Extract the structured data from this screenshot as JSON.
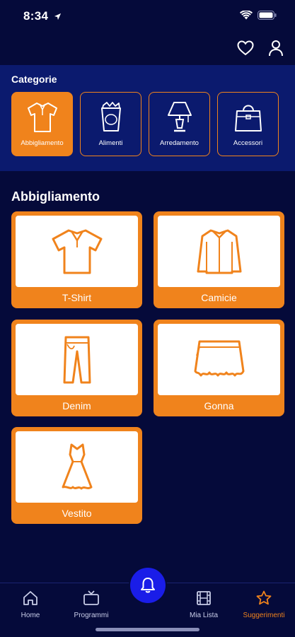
{
  "status": {
    "time": "8:34"
  },
  "categories": {
    "title": "Categorie",
    "items": [
      {
        "label": "Abbigliamento",
        "icon": "shirt-icon",
        "active": true
      },
      {
        "label": "Alimenti",
        "icon": "food-bag-icon",
        "active": false
      },
      {
        "label": "Arredamento",
        "icon": "lamp-icon",
        "active": false
      },
      {
        "label": "Accessori",
        "icon": "handbag-icon",
        "active": false
      }
    ]
  },
  "section": {
    "title": "Abbigliamento"
  },
  "products": [
    {
      "label": "T-Shirt",
      "icon": "tshirt-icon"
    },
    {
      "label": "Camicie",
      "icon": "dress-shirt-icon"
    },
    {
      "label": "Denim",
      "icon": "jeans-icon"
    },
    {
      "label": "Gonna",
      "icon": "skirt-icon"
    },
    {
      "label": "Vestito",
      "icon": "dress-icon"
    }
  ],
  "tabs": [
    {
      "label": "Home",
      "icon": "home-icon",
      "active": false
    },
    {
      "label": "Programmi",
      "icon": "tv-icon",
      "active": false
    },
    {
      "label": "Mia Lista",
      "icon": "film-icon",
      "active": false
    },
    {
      "label": "Suggerimenti",
      "icon": "star-icon",
      "active": true
    }
  ],
  "colors": {
    "background": "#050a3a",
    "category_panel": "#0b1a6e",
    "accent": "#f0831c",
    "fab": "#1a1de8"
  }
}
